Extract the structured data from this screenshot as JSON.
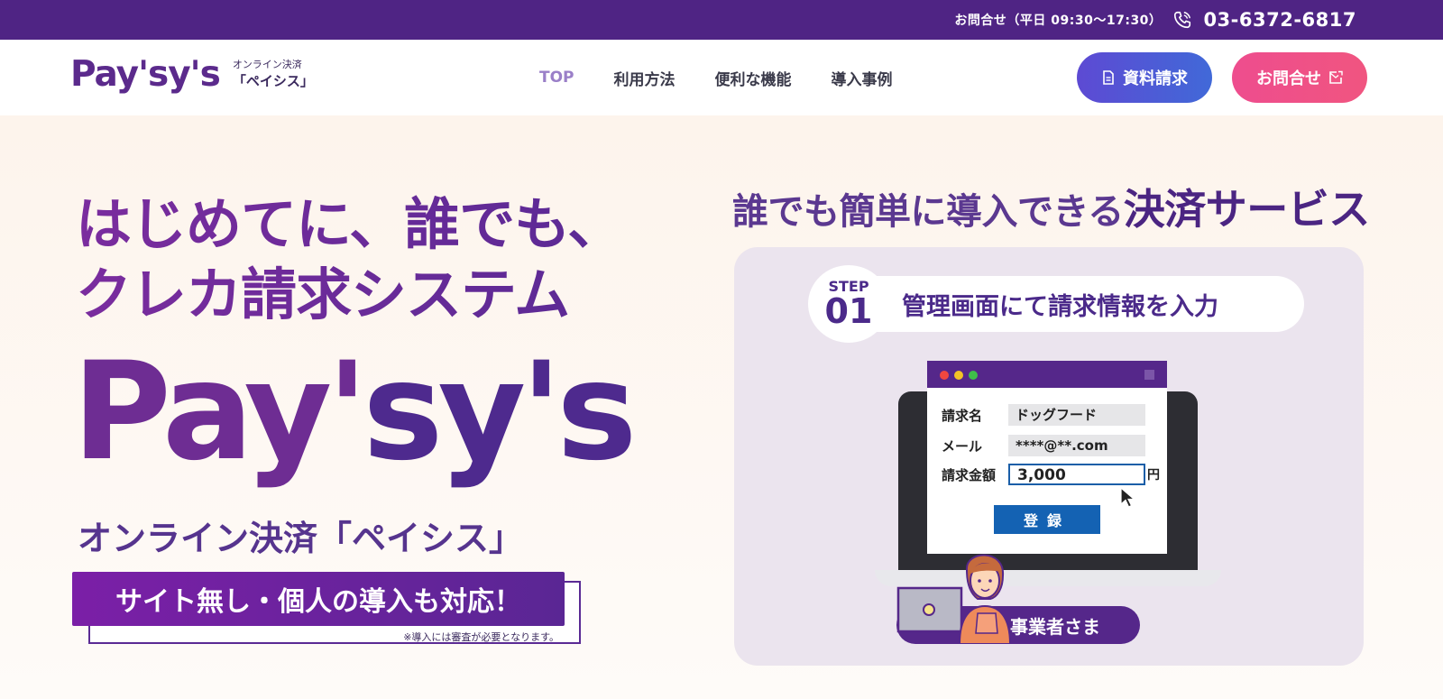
{
  "topbar": {
    "hours": "お問合せ（平日 09:30〜17:30）",
    "phone": "03-6372-6817"
  },
  "header": {
    "logo_text": "Pay'sy's",
    "logo_sub_small": "オンライン決済",
    "logo_sub_big": "「ペイシス」",
    "nav": [
      "TOP",
      "利用方法",
      "便利な機能",
      "導入事例"
    ],
    "doc_button": "資料請求",
    "contact_button": "お問合せ"
  },
  "hero": {
    "headline_line1": "はじめてに、誰でも、",
    "headline_line2": "クレカ請求システム",
    "brand_part1": "Pay'",
    "brand_part2": "sy's",
    "subbrand": "オンライン決済「ペイシス」",
    "ribbon": "サイト無し・個人の導入も対応！",
    "ribbon_note": "※導入には審査が必要となります。"
  },
  "right": {
    "title_plain": "誰でも簡単に導入できる",
    "title_em": "決済サービス",
    "step_label": "STEP",
    "step_num": "01",
    "step_text": "管理画面にて請求情報を入力",
    "form": {
      "row1_label": "請求名",
      "row1_value": "ドッグフード",
      "row2_label": "メール",
      "row2_value": "****@**.com",
      "row3_label": "請求金額",
      "row3_value": "3,000",
      "yen": "円",
      "register": "登録"
    },
    "biz_label": "事業者さま"
  },
  "colors": {
    "topbar": "#4f2484",
    "doc_button": "#4f5ad6",
    "contact_button": "#ee4d8e",
    "brand_purple": "#5b2a8c"
  }
}
